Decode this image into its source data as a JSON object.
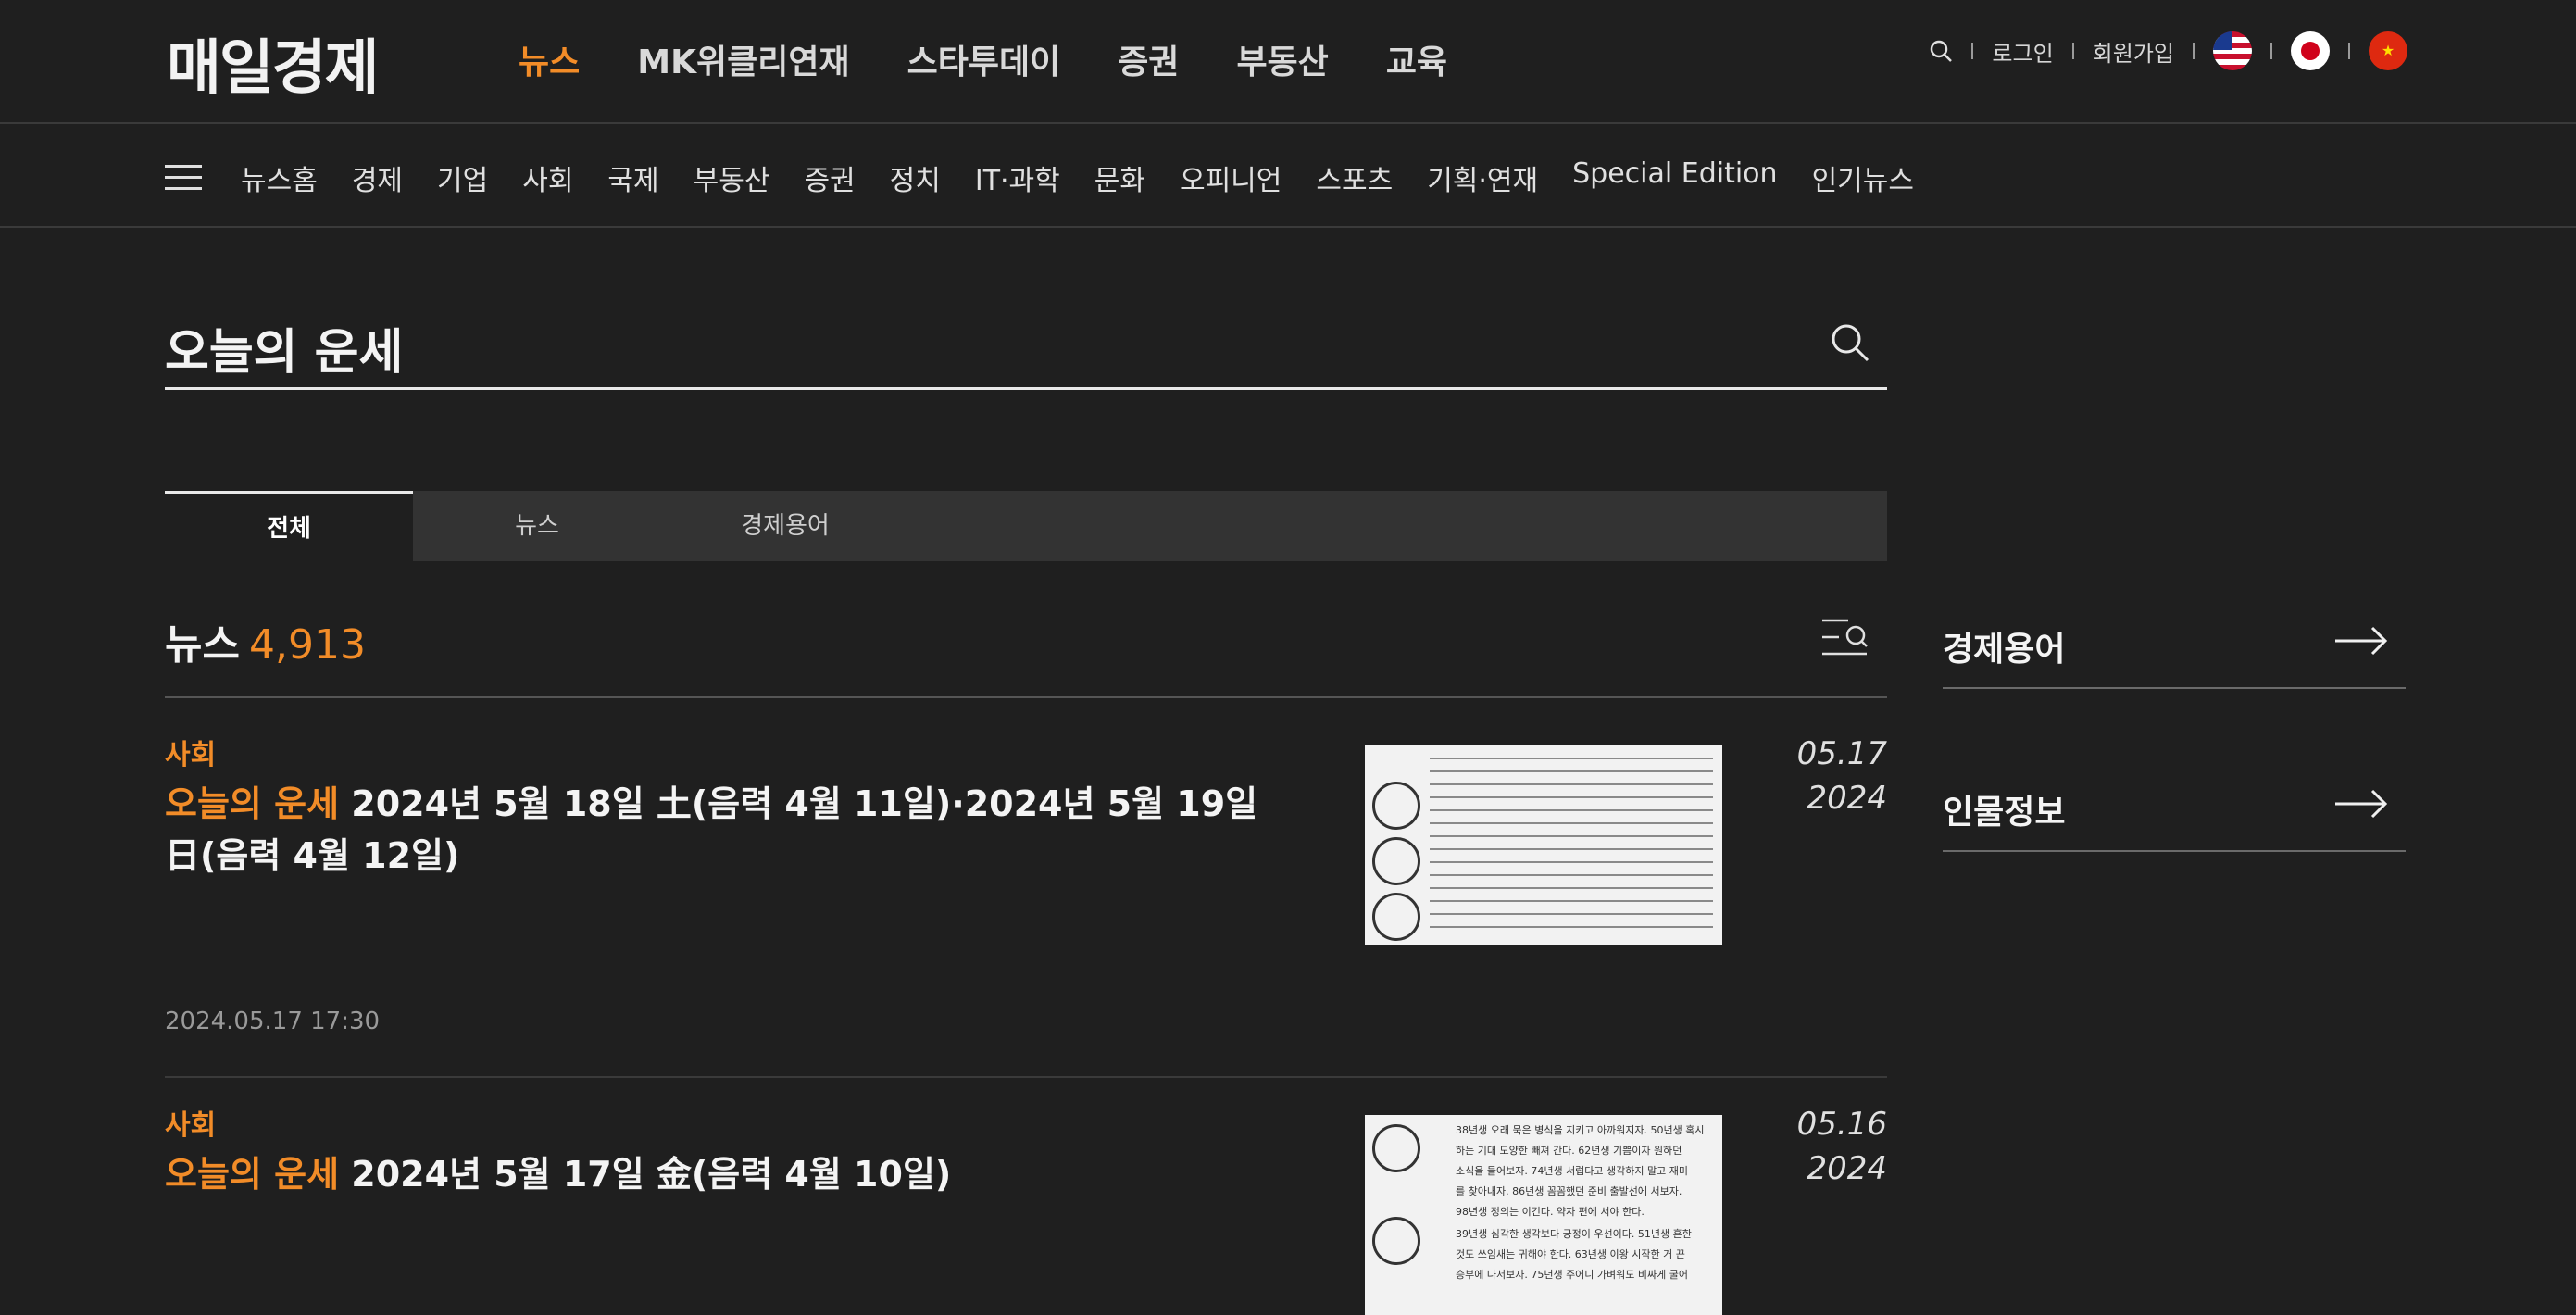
{
  "header": {
    "logo": "매일경제",
    "nav": [
      "뉴스",
      "MK위클리연재",
      "스타투데이",
      "증권",
      "부동산",
      "교육"
    ],
    "active_nav": "뉴스",
    "login": "로그인",
    "signup": "회원가입",
    "flags": [
      "us-flag-icon",
      "jp-flag-icon",
      "cn-flag-icon"
    ]
  },
  "subnav": {
    "items": [
      "뉴스홈",
      "경제",
      "기업",
      "사회",
      "국제",
      "부동산",
      "증권",
      "정치",
      "IT·과학",
      "문화",
      "오피니언",
      "스포츠",
      "기획·연재",
      "Special Edition",
      "인기뉴스"
    ]
  },
  "search": {
    "query": "오늘의 운세"
  },
  "tabs": [
    "전체",
    "뉴스",
    "경제용어"
  ],
  "results": {
    "label": "뉴스",
    "count": "4,913"
  },
  "articles": [
    {
      "category": "사회",
      "highlight": "오늘의 운세",
      "title_rest": " 2024년 5월 18일 土(음력 4월 11일)·2024년 5월 19일 日(음력 4월 12일)",
      "datetime": "2024.05.17 17:30",
      "date_md": "05.17",
      "date_y": "2024"
    },
    {
      "category": "사회",
      "highlight": "오늘의 운세",
      "title_rest": " 2024년 5월 17일 金(음력 4월 10일)",
      "date_md": "05.16",
      "date_y": "2024",
      "thumb_lines": [
        "38년생 오래 묵은 병식을 지키고 아까워지자. 50년생 혹시",
        "하는 기대 모양한 빼져 간다. 62년생 기쁨이자 원하던",
        "소식을 들어보자. 74년생 서럽다고 생각하지 말고 재미",
        "를 찾아내자. 86년생 꼼꼼했던 준비 출발선에 서보자.",
        "98년생 정의는 이긴다. 약자 편에 서야 한다.",
        "39년생 심각한 생각보다 긍정이 우선이다. 51년생 흔한",
        "것도 쓰임새는 귀해야 한다. 63년생 이왕 시작한 거 끈",
        "승부에 나서보자. 75년생 주어니 가벼워도 비싸게 굴어"
      ]
    }
  ],
  "sidebar": [
    "경제용어",
    "인물정보"
  ],
  "colors": {
    "accent": "#f28c28",
    "background": "#1f1f1f"
  }
}
